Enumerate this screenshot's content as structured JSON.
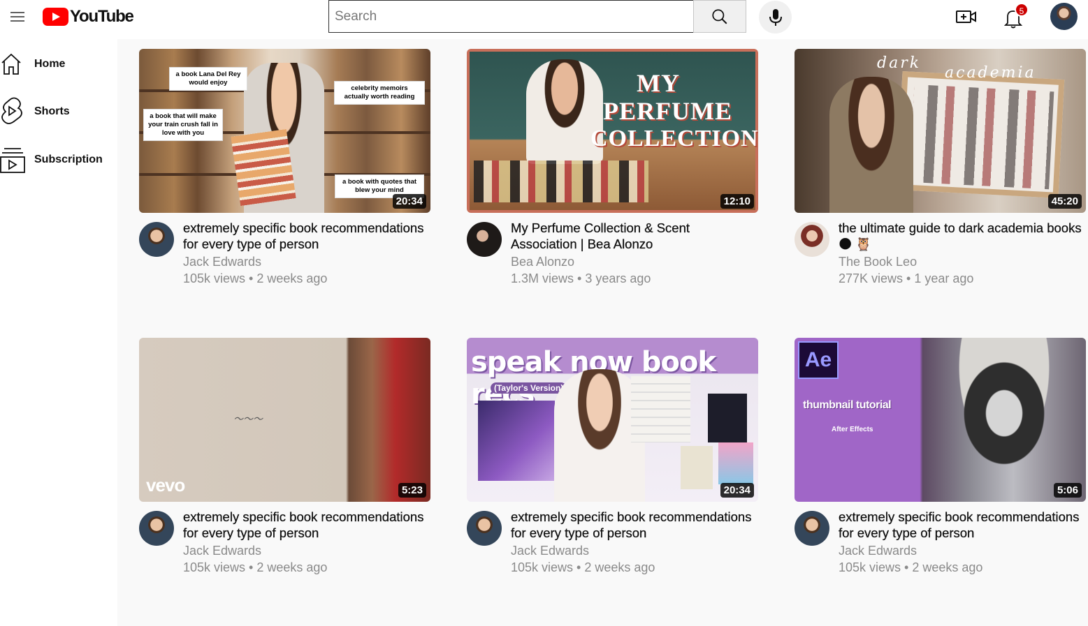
{
  "header": {
    "logo_text": "YouTube",
    "search": {
      "placeholder": "Search",
      "value": ""
    },
    "notifications": {
      "count": "5"
    }
  },
  "sidebar": {
    "items": [
      {
        "label": "Home",
        "icon": "home-icon"
      },
      {
        "label": "Shorts",
        "icon": "shorts-icon"
      },
      {
        "label": "Subscription",
        "icon": "subscriptions-icon"
      }
    ]
  },
  "videos": [
    {
      "title": "extremely specific book recommendations for every type of person",
      "channel": "Jack Edwards",
      "stats": "105k views • 2 weeks ago",
      "duration": "20:34",
      "thumb_notes": [
        "a book Lana Del Rey would enjoy",
        "celebrity memoirs actually worth reading",
        "a book that will make your train crush fall in love with you",
        "a book with quotes that blew your mind"
      ]
    },
    {
      "title": "My Perfume Collection & Scent Association | Bea Alonzo",
      "channel": "Bea Alonzo",
      "stats": "1.3M views • 3 years ago",
      "duration": "12:10",
      "thumb_text": [
        "MY",
        "PERFUME",
        "COLLECTION"
      ]
    },
    {
      "title": "the ultimate guide to dark academia books 🌑 🦉",
      "channel": "The Book Leo",
      "stats": "277K views • 1 year ago",
      "duration": "45:20",
      "thumb_text": [
        "dark",
        "academia"
      ]
    },
    {
      "title": "extremely specific book recommendations for every type of person",
      "channel": "Jack Edwards",
      "stats": "105k views • 2 weeks ago",
      "duration": "5:23",
      "thumb_text": [
        "vevo"
      ]
    },
    {
      "title": "extremely specific book recommendations for every type of person",
      "channel": "Jack Edwards",
      "stats": "105k views • 2 weeks ago",
      "duration": "20:34",
      "thumb_text": [
        "speak now book recs",
        "(Taylor's Version)"
      ]
    },
    {
      "title": "extremely specific book recommendations for every type of person",
      "channel": "Jack Edwards",
      "stats": "105k views • 2 weeks ago",
      "duration": "5:06",
      "thumb_text": [
        "Ae",
        "thumbnail tutorial",
        "After Effects"
      ]
    }
  ],
  "colors": {
    "brand_red": "#ff0000",
    "badge_red": "#cc0000",
    "text_primary": "#0f0f0f",
    "text_secondary": "#8a8a8a",
    "main_bg": "#f9f9f9"
  }
}
